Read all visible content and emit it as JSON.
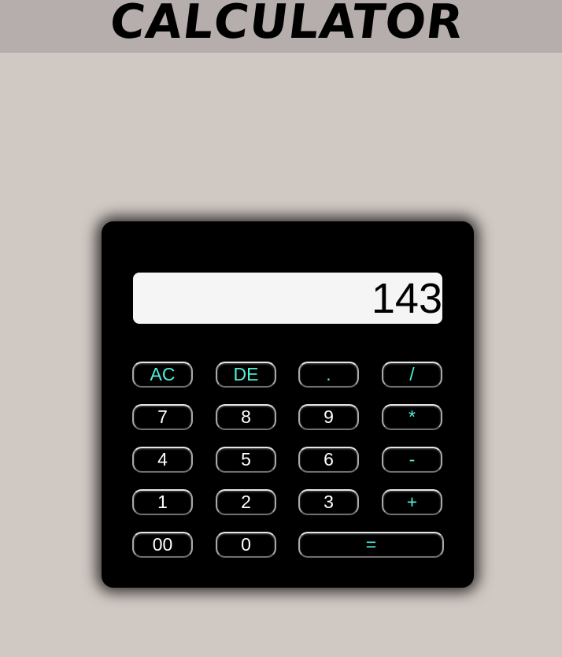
{
  "header": {
    "title": "CALCULATOR"
  },
  "display": {
    "value": "143"
  },
  "buttons": {
    "ac": "AC",
    "de": "DE",
    "dot": ".",
    "divide": "/",
    "seven": "7",
    "eight": "8",
    "nine": "9",
    "multiply": "*",
    "four": "4",
    "five": "5",
    "six": "6",
    "minus": "-",
    "one": "1",
    "two": "2",
    "three": "3",
    "plus": "+",
    "double_zero": "00",
    "zero": "0",
    "equals": "="
  },
  "colors": {
    "page_background": "#d0c8c3",
    "header_background": "#b6aeac",
    "calculator_body": "#000000",
    "display_background": "#f5f5f5",
    "operator_text": "#4ff0d8",
    "digit_text": "#ffffff"
  }
}
